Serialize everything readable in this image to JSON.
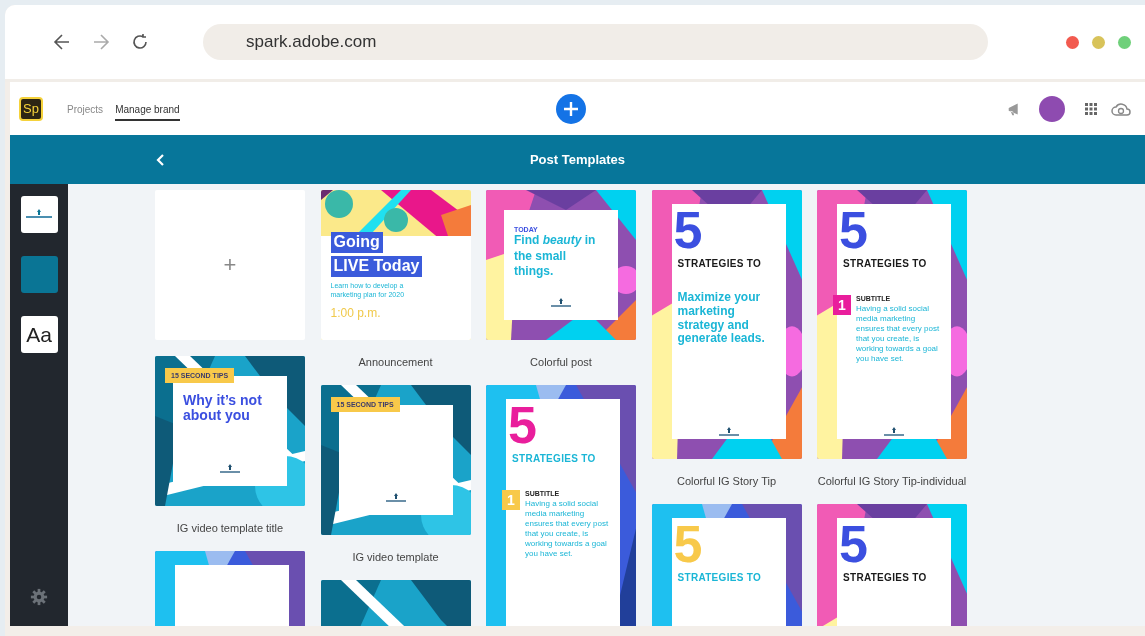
{
  "browser": {
    "url": "spark.adobe.com"
  },
  "app": {
    "logo": "Sp",
    "nav": [
      {
        "label": "Projects",
        "selected": false
      },
      {
        "label": "Manage brand",
        "selected": true
      }
    ]
  },
  "toolbar": {
    "title": "Post Templates"
  },
  "sidebar": {
    "tiles": [
      {
        "kind": "logo"
      },
      {
        "kind": "color",
        "color": "#0a7595"
      },
      {
        "kind": "font",
        "text": "Aa"
      }
    ]
  },
  "columns": [
    [
      {
        "kind": "new",
        "symbol": "+"
      },
      {
        "kind": "square",
        "label": "IG video template title",
        "lines": [
          {
            "kind": "tag",
            "text": "15 SECOND TIPS"
          },
          {
            "kind": "head",
            "text": "Why it’s not about you"
          }
        ]
      },
      {
        "kind": "story"
      }
    ],
    [
      {
        "kind": "split",
        "label": "Announcement",
        "lines": [
          {
            "kind": "highlight",
            "text": "Going"
          },
          {
            "kind": "highlight",
            "text": "LIVE Today"
          },
          {
            "kind": "small",
            "text": "Learn how to develop a marketing plan for 2020"
          },
          {
            "kind": "time",
            "text": "1:00 p.m."
          }
        ]
      },
      {
        "kind": "square",
        "label": "IG video template",
        "lines": [
          {
            "kind": "tag",
            "text": "15 SECOND TIPS"
          }
        ]
      },
      {
        "kind": "bare"
      }
    ],
    [
      {
        "kind": "square",
        "label": "Colorful post",
        "lines": [
          {
            "kind": "eyebrow",
            "text": "TODAY"
          },
          {
            "kind": "rich",
            "text": "Find *beauty* in the small things."
          }
        ]
      },
      {
        "kind": "story",
        "lines": [
          {
            "kind": "numeral",
            "text": "5",
            "color": "#e91e9c"
          },
          {
            "kind": "strap",
            "text": "STRATEGIES TO",
            "color": "#1bb6d6"
          },
          {
            "kind": "step",
            "number": "1",
            "color": "#f8c94a",
            "title": "SUBTITLE",
            "body": "Having a solid social media marketing ensures that every post that you create, is working towards a goal you have set."
          }
        ]
      }
    ],
    [
      {
        "kind": "story",
        "label": "Colorful IG Story Tip",
        "lines": [
          {
            "kind": "numeral",
            "text": "5",
            "color": "#3b4fe0"
          },
          {
            "kind": "strap",
            "text": "STRATEGIES TO",
            "color": "#1a1a1a"
          },
          {
            "kind": "lead",
            "text": "Maximize your marketing strategy and generate leads."
          }
        ]
      },
      {
        "kind": "story",
        "lines": [
          {
            "kind": "numeral",
            "text": "5",
            "color": "#f8c94a"
          },
          {
            "kind": "strap",
            "text": "STRATEGIES TO",
            "color": "#1bb6d6"
          }
        ]
      }
    ],
    [
      {
        "kind": "story",
        "label": "Colorful IG Story Tip-individual",
        "lines": [
          {
            "kind": "numeral",
            "text": "5",
            "color": "#3b4fe0"
          },
          {
            "kind": "strap",
            "text": "STRATEGIES TO",
            "color": "#1a1a1a"
          },
          {
            "kind": "step",
            "number": "1",
            "color": "#e91e9c",
            "title": "SUBTITLE",
            "body": "Having a solid social media marketing ensures that every post that you create, is working towards a goal you have set."
          }
        ]
      },
      {
        "kind": "story",
        "lines": [
          {
            "kind": "numeral",
            "text": "5",
            "color": "#3b4fe0"
          },
          {
            "kind": "strap",
            "text": "STRATEGIES TO",
            "color": "#1a1a1a"
          }
        ]
      }
    ]
  ]
}
